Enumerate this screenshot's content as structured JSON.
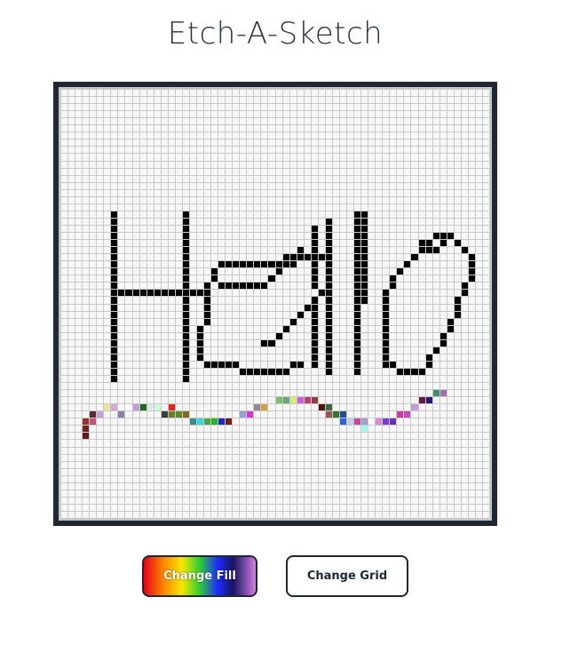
{
  "title": "Etch-A-Sketch",
  "buttons": {
    "change_fill": "Change Fill",
    "change_grid": "Change Grid"
  },
  "grid": {
    "size": 60,
    "empty_color": "#f7f7f7",
    "line_color": "#c8c8c8",
    "painted": [
      [
        7,
        17,
        "#000"
      ],
      [
        7,
        18,
        "#000"
      ],
      [
        7,
        19,
        "#000"
      ],
      [
        7,
        20,
        "#000"
      ],
      [
        7,
        21,
        "#000"
      ],
      [
        7,
        22,
        "#000"
      ],
      [
        7,
        23,
        "#000"
      ],
      [
        7,
        24,
        "#000"
      ],
      [
        7,
        25,
        "#000"
      ],
      [
        7,
        26,
        "#000"
      ],
      [
        7,
        27,
        "#000"
      ],
      [
        7,
        28,
        "#000"
      ],
      [
        7,
        29,
        "#000"
      ],
      [
        7,
        30,
        "#000"
      ],
      [
        7,
        31,
        "#000"
      ],
      [
        7,
        32,
        "#000"
      ],
      [
        7,
        33,
        "#000"
      ],
      [
        7,
        34,
        "#000"
      ],
      [
        7,
        35,
        "#000"
      ],
      [
        7,
        36,
        "#000"
      ],
      [
        7,
        37,
        "#000"
      ],
      [
        7,
        38,
        "#000"
      ],
      [
        7,
        39,
        "#000"
      ],
      [
        7,
        40,
        "#000"
      ],
      [
        8,
        28,
        "#000"
      ],
      [
        9,
        28,
        "#000"
      ],
      [
        10,
        28,
        "#000"
      ],
      [
        11,
        28,
        "#000"
      ],
      [
        12,
        28,
        "#000"
      ],
      [
        13,
        28,
        "#000"
      ],
      [
        14,
        28,
        "#000"
      ],
      [
        15,
        28,
        "#000"
      ],
      [
        16,
        28,
        "#000"
      ],
      [
        17,
        28,
        "#000"
      ],
      [
        17,
        17,
        "#000"
      ],
      [
        17,
        18,
        "#000"
      ],
      [
        17,
        19,
        "#000"
      ],
      [
        17,
        20,
        "#000"
      ],
      [
        17,
        21,
        "#000"
      ],
      [
        17,
        22,
        "#000"
      ],
      [
        17,
        23,
        "#000"
      ],
      [
        17,
        24,
        "#000"
      ],
      [
        17,
        25,
        "#000"
      ],
      [
        17,
        26,
        "#000"
      ],
      [
        17,
        27,
        "#000"
      ],
      [
        17,
        29,
        "#000"
      ],
      [
        17,
        30,
        "#000"
      ],
      [
        17,
        31,
        "#000"
      ],
      [
        17,
        32,
        "#000"
      ],
      [
        17,
        33,
        "#000"
      ],
      [
        17,
        34,
        "#000"
      ],
      [
        17,
        35,
        "#000"
      ],
      [
        17,
        36,
        "#000"
      ],
      [
        17,
        37,
        "#000"
      ],
      [
        17,
        38,
        "#000"
      ],
      [
        17,
        39,
        "#000"
      ],
      [
        17,
        40,
        "#000"
      ],
      [
        18,
        28,
        "#000"
      ],
      [
        19,
        28,
        "#000"
      ],
      [
        20,
        27,
        "#000"
      ],
      [
        20,
        28,
        "#000"
      ],
      [
        20,
        29,
        "#000"
      ],
      [
        20,
        30,
        "#000"
      ],
      [
        20,
        31,
        "#000"
      ],
      [
        20,
        32,
        "#000"
      ],
      [
        19,
        33,
        "#000"
      ],
      [
        19,
        34,
        "#000"
      ],
      [
        19,
        35,
        "#000"
      ],
      [
        19,
        36,
        "#000"
      ],
      [
        19,
        37,
        "#000"
      ],
      [
        20,
        38,
        "#000"
      ],
      [
        21,
        38,
        "#000"
      ],
      [
        22,
        38,
        "#000"
      ],
      [
        23,
        38,
        "#000"
      ],
      [
        24,
        38,
        "#000"
      ],
      [
        21,
        25,
        "#000"
      ],
      [
        22,
        24,
        "#000"
      ],
      [
        23,
        24,
        "#000"
      ],
      [
        24,
        24,
        "#000"
      ],
      [
        21,
        26,
        "#000"
      ],
      [
        22,
        27,
        "#000"
      ],
      [
        23,
        27,
        "#000"
      ],
      [
        24,
        27,
        "#000"
      ],
      [
        25,
        27,
        "#000"
      ],
      [
        26,
        27,
        "#000"
      ],
      [
        27,
        27,
        "#000"
      ],
      [
        28,
        27,
        "#000"
      ],
      [
        29,
        26,
        "#000"
      ],
      [
        30,
        25,
        "#000"
      ],
      [
        31,
        24,
        "#000"
      ],
      [
        32,
        24,
        "#000"
      ],
      [
        33,
        23,
        "#000"
      ],
      [
        34,
        23,
        "#000"
      ],
      [
        35,
        23,
        "#000"
      ],
      [
        36,
        23,
        "#000"
      ],
      [
        25,
        24,
        "#000"
      ],
      [
        26,
        24,
        "#000"
      ],
      [
        27,
        24,
        "#000"
      ],
      [
        28,
        24,
        "#000"
      ],
      [
        29,
        24,
        "#000"
      ],
      [
        30,
        24,
        "#000"
      ],
      [
        31,
        23,
        "#000"
      ],
      [
        32,
        23,
        "#000"
      ],
      [
        33,
        22,
        "#000"
      ],
      [
        25,
        39,
        "#000"
      ],
      [
        26,
        39,
        "#000"
      ],
      [
        27,
        39,
        "#000"
      ],
      [
        28,
        39,
        "#000"
      ],
      [
        29,
        39,
        "#000"
      ],
      [
        30,
        39,
        "#000"
      ],
      [
        31,
        39,
        "#000"
      ],
      [
        32,
        38,
        "#000"
      ],
      [
        33,
        38,
        "#000"
      ],
      [
        28,
        35,
        "#000"
      ],
      [
        29,
        35,
        "#000"
      ],
      [
        30,
        34,
        "#000"
      ],
      [
        31,
        33,
        "#000"
      ],
      [
        32,
        32,
        "#000"
      ],
      [
        33,
        31,
        "#000"
      ],
      [
        34,
        30,
        "#000"
      ],
      [
        35,
        29,
        "#000"
      ],
      [
        36,
        28,
        "#000"
      ],
      [
        35,
        30,
        "#000"
      ],
      [
        35,
        31,
        "#000"
      ],
      [
        35,
        32,
        "#000"
      ],
      [
        35,
        33,
        "#000"
      ],
      [
        35,
        34,
        "#000"
      ],
      [
        35,
        35,
        "#000"
      ],
      [
        35,
        36,
        "#000"
      ],
      [
        35,
        37,
        "#000"
      ],
      [
        35,
        38,
        "#000"
      ],
      [
        37,
        28,
        "#000"
      ],
      [
        37,
        29,
        "#000"
      ],
      [
        37,
        30,
        "#000"
      ],
      [
        37,
        31,
        "#000"
      ],
      [
        37,
        32,
        "#000"
      ],
      [
        37,
        33,
        "#000"
      ],
      [
        37,
        34,
        "#000"
      ],
      [
        37,
        35,
        "#000"
      ],
      [
        37,
        36,
        "#000"
      ],
      [
        37,
        37,
        "#000"
      ],
      [
        37,
        38,
        "#000"
      ],
      [
        37,
        39,
        "#000"
      ],
      [
        35,
        19,
        "#000"
      ],
      [
        35,
        20,
        "#000"
      ],
      [
        35,
        21,
        "#000"
      ],
      [
        35,
        22,
        "#000"
      ],
      [
        35,
        23,
        "#000"
      ],
      [
        35,
        24,
        "#000"
      ],
      [
        35,
        25,
        "#000"
      ],
      [
        35,
        26,
        "#000"
      ],
      [
        35,
        27,
        "#000"
      ],
      [
        37,
        18,
        "#000"
      ],
      [
        37,
        19,
        "#000"
      ],
      [
        37,
        20,
        "#000"
      ],
      [
        37,
        21,
        "#000"
      ],
      [
        37,
        22,
        "#000"
      ],
      [
        37,
        23,
        "#000"
      ],
      [
        37,
        24,
        "#000"
      ],
      [
        37,
        25,
        "#000"
      ],
      [
        37,
        26,
        "#000"
      ],
      [
        37,
        27,
        "#000"
      ],
      [
        41,
        17,
        "#000"
      ],
      [
        41,
        18,
        "#000"
      ],
      [
        41,
        19,
        "#000"
      ],
      [
        41,
        20,
        "#000"
      ],
      [
        41,
        21,
        "#000"
      ],
      [
        41,
        22,
        "#000"
      ],
      [
        41,
        23,
        "#000"
      ],
      [
        41,
        24,
        "#000"
      ],
      [
        41,
        25,
        "#000"
      ],
      [
        41,
        26,
        "#000"
      ],
      [
        41,
        27,
        "#000"
      ],
      [
        41,
        28,
        "#000"
      ],
      [
        41,
        29,
        "#000"
      ],
      [
        41,
        30,
        "#000"
      ],
      [
        41,
        31,
        "#000"
      ],
      [
        41,
        32,
        "#000"
      ],
      [
        41,
        33,
        "#000"
      ],
      [
        41,
        34,
        "#000"
      ],
      [
        41,
        35,
        "#000"
      ],
      [
        41,
        36,
        "#000"
      ],
      [
        41,
        37,
        "#000"
      ],
      [
        41,
        38,
        "#000"
      ],
      [
        41,
        39,
        "#000"
      ],
      [
        42,
        17,
        "#000"
      ],
      [
        42,
        18,
        "#000"
      ],
      [
        42,
        19,
        "#000"
      ],
      [
        42,
        20,
        "#000"
      ],
      [
        42,
        21,
        "#000"
      ],
      [
        42,
        22,
        "#000"
      ],
      [
        42,
        23,
        "#000"
      ],
      [
        42,
        24,
        "#000"
      ],
      [
        42,
        25,
        "#000"
      ],
      [
        42,
        26,
        "#000"
      ],
      [
        42,
        27,
        "#000"
      ],
      [
        42,
        28,
        "#000"
      ],
      [
        42,
        29,
        "#000"
      ],
      [
        45,
        28,
        "#000"
      ],
      [
        45,
        29,
        "#000"
      ],
      [
        45,
        30,
        "#000"
      ],
      [
        45,
        31,
        "#000"
      ],
      [
        45,
        32,
        "#000"
      ],
      [
        45,
        33,
        "#000"
      ],
      [
        45,
        34,
        "#000"
      ],
      [
        45,
        35,
        "#000"
      ],
      [
        45,
        36,
        "#000"
      ],
      [
        45,
        37,
        "#000"
      ],
      [
        45,
        38,
        "#000"
      ],
      [
        46,
        26,
        "#000"
      ],
      [
        46,
        27,
        "#000"
      ],
      [
        47,
        25,
        "#000"
      ],
      [
        48,
        24,
        "#000"
      ],
      [
        49,
        23,
        "#000"
      ],
      [
        50,
        22,
        "#000"
      ],
      [
        51,
        21,
        "#000"
      ],
      [
        52,
        20,
        "#000"
      ],
      [
        53,
        20,
        "#000"
      ],
      [
        54,
        20,
        "#000"
      ],
      [
        55,
        21,
        "#000"
      ],
      [
        56,
        22,
        "#000"
      ],
      [
        57,
        23,
        "#000"
      ],
      [
        57,
        24,
        "#000"
      ],
      [
        57,
        25,
        "#000"
      ],
      [
        57,
        26,
        "#000"
      ],
      [
        56,
        27,
        "#000"
      ],
      [
        56,
        28,
        "#000"
      ],
      [
        55,
        29,
        "#000"
      ],
      [
        55,
        30,
        "#000"
      ],
      [
        55,
        31,
        "#000"
      ],
      [
        54,
        32,
        "#000"
      ],
      [
        54,
        33,
        "#000"
      ],
      [
        53,
        34,
        "#000"
      ],
      [
        53,
        35,
        "#000"
      ],
      [
        52,
        36,
        "#000"
      ],
      [
        51,
        37,
        "#000"
      ],
      [
        46,
        38,
        "#000"
      ],
      [
        47,
        39,
        "#000"
      ],
      [
        48,
        39,
        "#000"
      ],
      [
        49,
        39,
        "#000"
      ],
      [
        50,
        39,
        "#000"
      ],
      [
        51,
        38,
        "#000"
      ],
      [
        50,
        21,
        "#000"
      ],
      [
        51,
        22,
        "#000"
      ],
      [
        52,
        22,
        "#000"
      ],
      [
        53,
        21,
        "#000"
      ],
      [
        3,
        46,
        "#a32b2b"
      ],
      [
        3,
        47,
        "#7a1e1e"
      ],
      [
        3,
        48,
        "#6b1717"
      ],
      [
        4,
        46,
        "#d24a78"
      ],
      [
        4,
        45,
        "#5e2a2a"
      ],
      [
        5,
        45,
        "#c9a0dc"
      ],
      [
        6,
        44,
        "#f0e58a"
      ],
      [
        7,
        44,
        "#d9a6e0"
      ],
      [
        8,
        45,
        "#8b7fa7"
      ],
      [
        9,
        44,
        "#ffffff"
      ],
      [
        10,
        44,
        "#c99bd6"
      ],
      [
        11,
        44,
        "#1f6b2a"
      ],
      [
        12,
        44,
        "#e6e6e6"
      ],
      [
        13,
        44,
        "#c9ffe0"
      ],
      [
        14,
        45,
        "#3b3b3b"
      ],
      [
        15,
        44,
        "#e02b1f"
      ],
      [
        15,
        45,
        "#6f7a2a"
      ],
      [
        16,
        45,
        "#5c8a2c"
      ],
      [
        17,
        45,
        "#7b6a2b"
      ],
      [
        18,
        46,
        "#3f8a8a"
      ],
      [
        19,
        46,
        "#39d4d4"
      ],
      [
        20,
        46,
        "#50a050"
      ],
      [
        21,
        46,
        "#2ab22a"
      ],
      [
        22,
        46,
        "#2626c8"
      ],
      [
        23,
        46,
        "#6a1f1f"
      ],
      [
        24,
        45,
        "#ffffff"
      ],
      [
        25,
        45,
        "#8fa4d4"
      ],
      [
        26,
        45,
        "#e033c9"
      ],
      [
        27,
        44,
        "#8a8a9a"
      ],
      [
        28,
        44,
        "#d6a04a"
      ],
      [
        30,
        43,
        "#7dbf6a"
      ],
      [
        31,
        43,
        "#6fa86f"
      ],
      [
        32,
        43,
        "#d0f070"
      ],
      [
        33,
        43,
        "#e055e0"
      ],
      [
        34,
        43,
        "#c83a6a"
      ],
      [
        35,
        43,
        "#9b3a3a"
      ],
      [
        36,
        44,
        "#5c1010"
      ],
      [
        37,
        44,
        "#3b6b3b"
      ],
      [
        37,
        45,
        "#a05050"
      ],
      [
        38,
        45,
        "#2b7a2b"
      ],
      [
        39,
        46,
        "#2266dd"
      ],
      [
        40,
        46,
        "#c8c8e8"
      ],
      [
        41,
        46,
        "#d040a0"
      ],
      [
        42,
        46,
        "#a0a0c8"
      ],
      [
        43,
        46,
        "#ffffff"
      ],
      [
        44,
        46,
        "#d888d8"
      ],
      [
        45,
        46,
        "#7a3ae0"
      ],
      [
        46,
        46,
        "#6a2ad0"
      ],
      [
        47,
        45,
        "#e030b0"
      ],
      [
        48,
        45,
        "#d040d0"
      ],
      [
        49,
        44,
        "#c89ad8"
      ],
      [
        50,
        43,
        "#5a2040"
      ],
      [
        51,
        43,
        "#2a1a6a"
      ],
      [
        52,
        42,
        "#4a8a6a"
      ],
      [
        53,
        42,
        "#a070a8"
      ],
      [
        42,
        47,
        "#a0ffee"
      ],
      [
        39,
        45,
        "#1e4e8e"
      ]
    ]
  }
}
